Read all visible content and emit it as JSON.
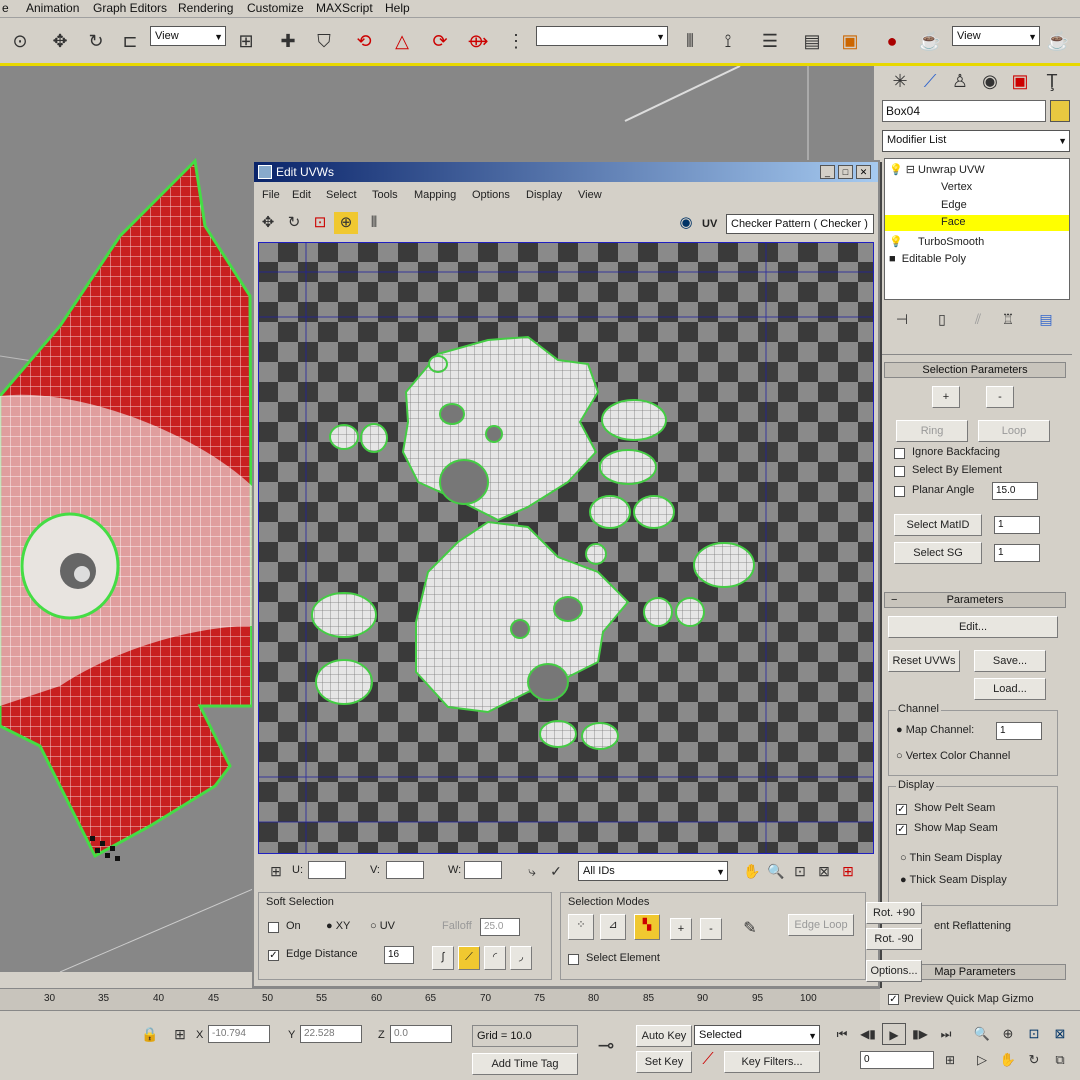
{
  "menubar": {
    "items": [
      "e",
      "Animation",
      "Graph Editors",
      "Rendering",
      "Customize",
      "MAXScript",
      "Help"
    ]
  },
  "toolbar": {
    "view_dropdown_1": "View",
    "view_dropdown_2": "View"
  },
  "command_panel": {
    "object_name": "Box04",
    "modifier_list": "Modifier List",
    "stack": {
      "unwrap": "Unwrap UVW",
      "vertex": "Vertex",
      "edge": "Edge",
      "face": "Face",
      "turbosmooth": "TurboSmooth",
      "editable_poly": "Editable Poly"
    },
    "selection_parameters": {
      "title": "Selection Parameters",
      "plus": "+",
      "minus": "-",
      "ring": "Ring",
      "loop": "Loop",
      "ignore_backfacing": "Ignore Backfacing",
      "select_by_element": "Select By Element",
      "planar_angle": "Planar Angle",
      "planar_angle_value": "15.0",
      "select_matid": "Select MatID",
      "select_matid_value": "1",
      "select_sg": "Select SG",
      "select_sg_value": "1"
    },
    "parameters": {
      "title": "Parameters",
      "edit": "Edit...",
      "reset_uvws": "Reset UVWs",
      "save": "Save...",
      "load": "Load...",
      "channel_group": "Channel",
      "map_channel": "Map Channel:",
      "map_channel_value": "1",
      "vertex_color_channel": "Vertex Color Channel",
      "display_group": "Display",
      "show_pelt_seam": "Show Pelt Seam",
      "show_map_seam": "Show Map Seam",
      "thin_seam": "Thin Seam Display",
      "thick_seam": "Thick Seam Display",
      "prevent_reflattening": "ent Reflattening",
      "map_parameters": "Map Parameters",
      "preview_quick_map": "Preview Quick Map Gizmo"
    }
  },
  "uv_editor": {
    "title": "Edit UVWs",
    "menu": [
      "File",
      "Edit",
      "Select",
      "Tools",
      "Mapping",
      "Options",
      "Display",
      "View"
    ],
    "uv_label": "UV",
    "texture_dropdown": "Checker Pattern  ( Checker )",
    "bottom": {
      "u": "U:",
      "v": "V:",
      "w": "W:",
      "all_ids": "All IDs"
    },
    "soft_selection": {
      "title": "Soft Selection",
      "on": "On",
      "xy": "XY",
      "uv": "UV",
      "falloff": "Falloff",
      "falloff_value": "25.0",
      "edge_distance": "Edge Distance",
      "edge_distance_value": "16"
    },
    "selection_modes": {
      "title": "Selection Modes",
      "plus": "+",
      "minus": "-",
      "edge_loop": "Edge Loop",
      "select_element": "Select Element"
    },
    "rot_plus_90": "Rot. +90",
    "rot_minus_90": "Rot. -90",
    "options": "Options..."
  },
  "timeline": {
    "ticks": [
      "30",
      "35",
      "40",
      "45",
      "50",
      "55",
      "60",
      "65",
      "70",
      "75",
      "80",
      "85",
      "90",
      "95",
      "100"
    ]
  },
  "status": {
    "x_label": "X",
    "x_value": "-10.794",
    "y_label": "Y",
    "y_value": "22.528",
    "z_label": "Z",
    "z_value": "0.0",
    "grid": "Grid = 10.0",
    "add_time_tag": "Add Time Tag",
    "auto_key": "Auto Key",
    "selected": "Selected",
    "set_key": "Set Key",
    "key_filters": "Key Filters...",
    "frame": "0"
  }
}
